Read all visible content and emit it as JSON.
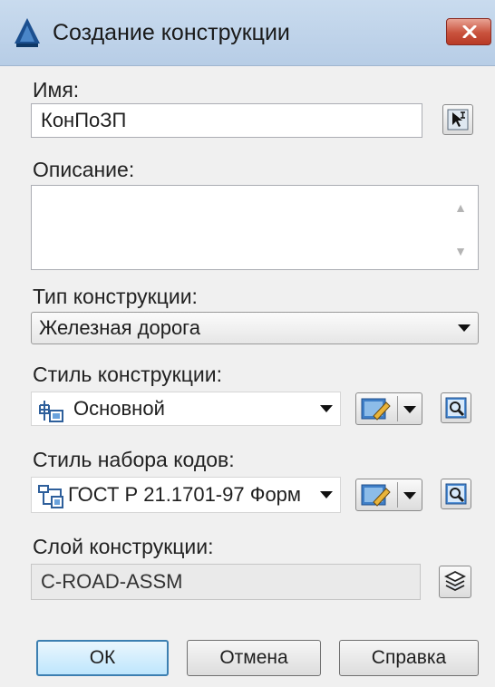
{
  "window": {
    "title": "Создание конструкции",
    "close_label": "close"
  },
  "name": {
    "label": "Имя:",
    "value": "КонПоЗП"
  },
  "description": {
    "label": "Описание:",
    "value": ""
  },
  "construction_type": {
    "label": "Тип конструкции:",
    "selected": "Железная дорога"
  },
  "construction_style": {
    "label": "Стиль конструкции:",
    "selected": "Основной"
  },
  "code_set_style": {
    "label": "Стиль набора кодов:",
    "selected": "ГОСТ Р 21.1701-97 Форм"
  },
  "construction_layer": {
    "label": "Слой конструкции:",
    "value": "C-ROAD-ASSM"
  },
  "buttons": {
    "ok": "ОК",
    "cancel": "Отмена",
    "help": "Справка"
  },
  "icons": {
    "app": "autocad-civil-icon",
    "pick": "pick-from-drawing-icon",
    "edit": "edit-style-icon",
    "preview": "preview-icon",
    "layer": "layers-icon"
  },
  "colors": {
    "titlebar": "#c9dbee",
    "close_button": "#c9523d",
    "default_button_border": "#3c7fb1"
  }
}
